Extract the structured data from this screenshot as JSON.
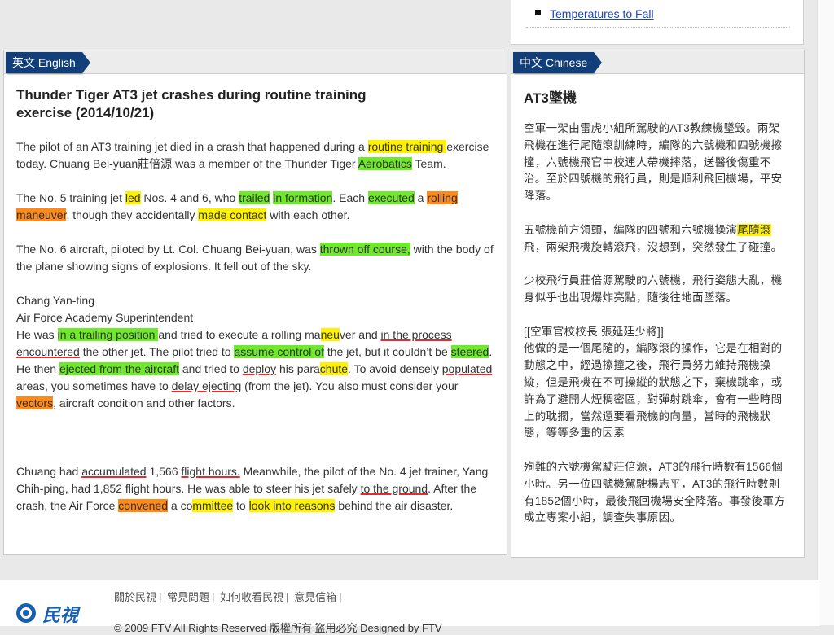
{
  "top_link": "Temperatures to Fall",
  "english_tab": "英文 English",
  "chinese_tab": "中文 Chinese",
  "en": {
    "title": "Thunder Tiger AT3 jet crashes during routine training exercise (2014/10/21)",
    "p1": [
      "The pilot of an AT3 training jet died in a crash that happened during a ",
      "routine training ",
      "exercise today. Chuang Bei-yuan莊倍源 was a member of the Thunder Tiger ",
      "Aerobatics",
      " Team."
    ],
    "p2": [
      "The No. 5 training jet ",
      "led",
      " Nos. 4 and 6, who ",
      "trailed",
      " ",
      "in formation",
      ". Each ",
      "executed",
      " a ",
      "rolling maneuver",
      ", though they accidentally ",
      "made contact",
      " with each other."
    ],
    "p3": [
      "The No. 6 aircraft, piloted by Lt. Col. Chuang Bei-yuan, was ",
      "thrown off course,",
      " with the body of the plane showing signs of explosions. It fell out of the sky."
    ],
    "p4_name": "Chang Yan-ting",
    "p4_role": "Air Force Academy Superintendent",
    "p4": [
      "He was ",
      "in a trailing position ",
      "and tried to execute a rolling ma",
      "neu",
      "ver and ",
      "in the process encountered",
      " the other jet. The pilot tried to ",
      "assume control of",
      " the jet, but it couldn’t be ",
      "steered",
      ". He then ",
      "ejected from the aircraft",
      " and tried to ",
      "deploy",
      " his para",
      "chute",
      ". To avoid densely ",
      "populated",
      " areas, you sometimes have to ",
      "delay ejecting",
      " (from the jet). You also must consider your ",
      "vectors",
      ", aircraft condition and other factors."
    ],
    "p5": [
      "Chuang had ",
      "accumulated",
      " 1,566 ",
      "flight hours.",
      " Meanwhile, the pilot of the No. 4 jet trainer, Yang Chih-ping, had 1,852 flight hours. He was able to steer his jet safely ",
      "to the ground",
      ". After the crash, the Air Force ",
      "convened",
      " a co",
      "mmittee",
      " to ",
      "look into reasons",
      " behind the air disaster."
    ]
  },
  "zh": {
    "title": "AT3墜機",
    "p1": "空軍一架由雷虎小組所駕駛的AT3教練機墜毀。兩架飛機在進行尾隨滾訓練時，編隊的六號機和四號機擦撞，六號機飛官中校連人帶機摔落，送醫後傷重不治。至於四號機的飛行員，則是順利飛回機場，平安降落。",
    "p2": [
      "五號機前方領頭，編隊的四號和六號機操演",
      "尾隨滾",
      "飛，兩架飛機旋轉滾飛，沒想到，突然發生了碰撞。"
    ],
    "p3": "少校飛行員莊倍源駕駛的六號機，飛行姿態大亂，機身似乎也出現爆炸亮點，隨後往地面墜落。",
    "p4_head": "[[空軍官校校長 張延廷少將]]",
    "p4": "他做的是一個尾隨的，編隊滾的操作，它是在相對的動態之中，經過擦撞之後，飛行員努力維持飛機操縱，但是飛機在不可操縱的狀態之下，棄機跳傘，或許為了避開人煙稠密區，對彈射跳傘，會有一些時間上的耽擱，當然還要看飛機的向量，當時的飛機狀態，等等多重的因素",
    "p5": "殉難的六號機駕駛莊倍源，AT3的飛行時數有1566個小時。另一位四號機駕駛楊志平，AT3的飛行時數則有1852個小時，最後飛回機場安全降落。事發後軍方成立專案小組，調查失事原因。"
  },
  "footer": {
    "links": [
      "關於民視",
      "常見問題",
      "如何收看民視",
      "意見信箱"
    ],
    "logo_text": "民視",
    "copyright": "© 2009 FTV All Rights Reserved 版權所有 盜用必究 Designed by FTV"
  },
  "colors": {
    "tab": "#123f79",
    "highlight_yellow": "#fff200",
    "highlight_green": "#6eea2b",
    "highlight_orange": "#ff8a1a",
    "underline_red": "#e62b2b",
    "link": "#1a44c2"
  }
}
